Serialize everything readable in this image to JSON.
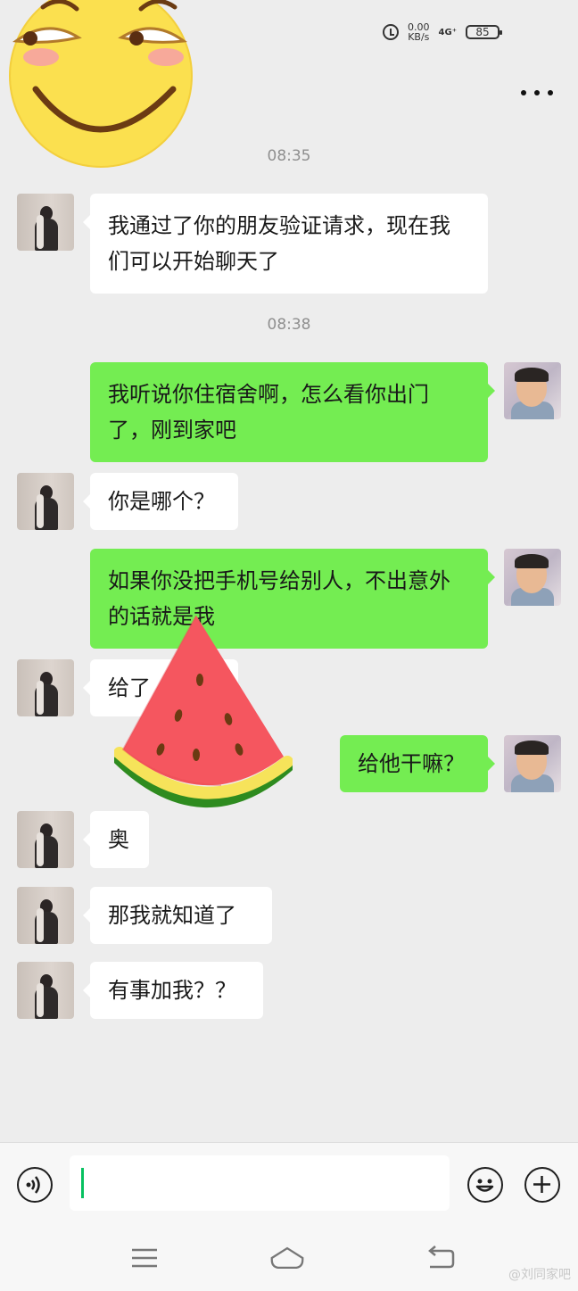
{
  "status_bar": {
    "net_speed": "0.00",
    "net_unit": "KB/s",
    "network": "4G⁺",
    "battery": "85"
  },
  "header": {
    "more_icon": "more-dots-icon"
  },
  "timestamps": [
    "08:35",
    "08:38"
  ],
  "messages": [
    {
      "from": "her",
      "text": "我通过了你的朋友验证请求，现在我们可以开始聊天了"
    },
    {
      "from": "me",
      "text": "我听说你住宿舍啊，怎么看你出门了，刚到家吧"
    },
    {
      "from": "her",
      "text": "你是哪个？"
    },
    {
      "from": "me",
      "text": "如果你没把手机号给别人，不出意外的话就是我"
    },
    {
      "from": "her",
      "text": "给了"
    },
    {
      "from": "me",
      "text": "给他干嘛？"
    },
    {
      "from": "her",
      "text": "奥"
    },
    {
      "from": "her",
      "text": "那我就知道了"
    },
    {
      "from": "her",
      "text": "有事加我？？"
    }
  ],
  "input_bar": {
    "voice_icon": "voice-icon",
    "emoji_icon": "emoji-icon",
    "plus_icon": "plus-icon",
    "value": ""
  },
  "nav_bar": {
    "menu_icon": "menu-icon",
    "home_icon": "home-icon",
    "back_icon": "back-icon",
    "watermark": "@刘同家吧"
  },
  "colors": {
    "background": "#ededed",
    "incoming_bubble": "#ffffff",
    "outgoing_bubble": "#74ed52",
    "timestamp": "#8f8f8f",
    "cursor": "#07c160"
  }
}
